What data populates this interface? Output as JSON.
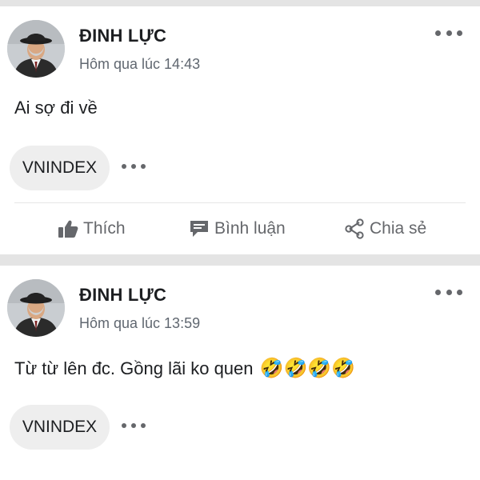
{
  "posts": [
    {
      "author": "ĐINH LỰC",
      "timestamp": "Hôm qua lúc 14:43",
      "text": "Ai sợ đi về",
      "emojis": "",
      "tag": "VNINDEX",
      "actions": {
        "like": "Thích",
        "comment": "Bình luận",
        "share": "Chia sẻ"
      }
    },
    {
      "author": "ĐINH LỰC",
      "timestamp": "Hôm qua lúc 13:59",
      "text": "Từ từ lên đc. Gồng lãi ko quen",
      "emojis": "🤣🤣🤣🤣",
      "tag": "VNINDEX"
    }
  ],
  "icons": {
    "more": "more-horizontal-icon",
    "like": "thumbs-up-icon",
    "comment": "comment-icon",
    "share": "share-icon"
  },
  "colors": {
    "text": "#1c1e21",
    "secondary": "#65676b",
    "timestamp": "#606770",
    "background": "#e4e4e4",
    "tag_bg": "#eeeeee"
  }
}
